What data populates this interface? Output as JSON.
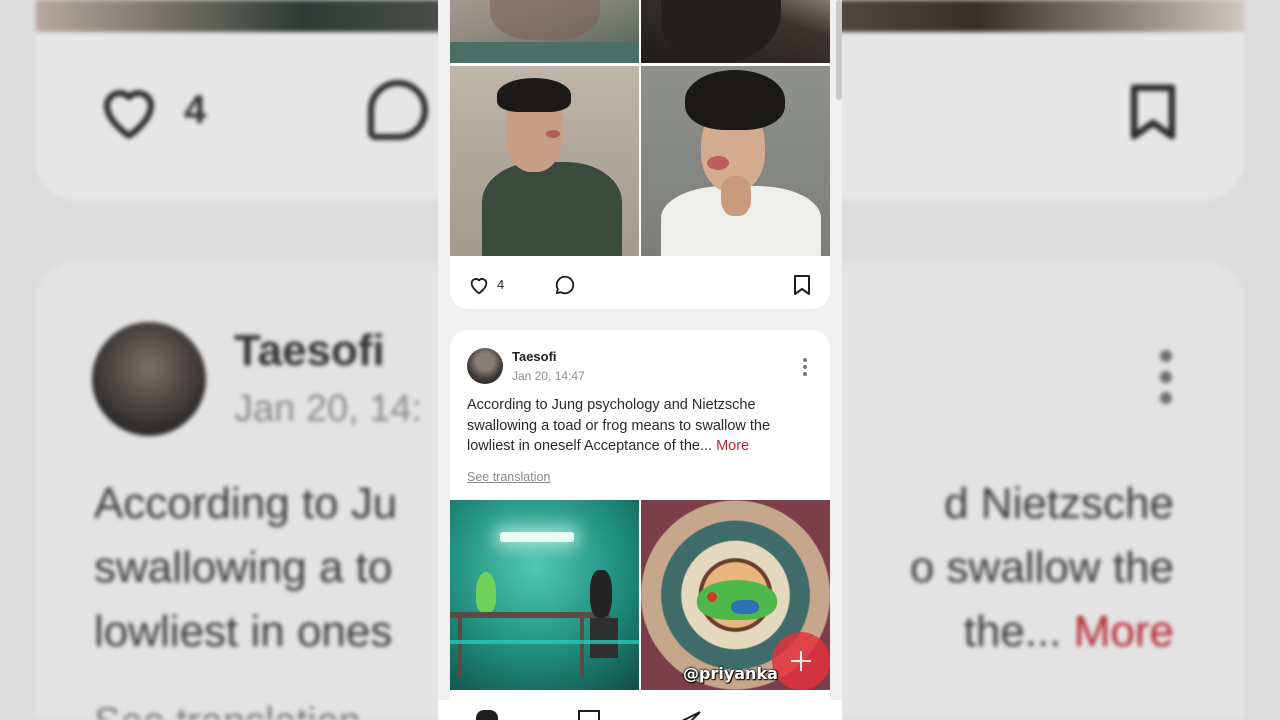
{
  "feed": {
    "post_above": {
      "likes": "4"
    },
    "post": {
      "author": "Taesofi",
      "date": "Jan 20, 14:47",
      "text": "According to Jung psychology and Nietzsche swallowing a toad or frog means to swallow the lowliest in oneself Acceptance of the...",
      "more_label": "More",
      "see_translation": "See translation"
    }
  },
  "background_zoom": {
    "likes": "4",
    "author": "Taesofi",
    "date_partial": "Jan 20, 14:",
    "text_line1": "According to Ju",
    "text_line1_right": "d Nietzsche",
    "text_line2": "swallowing a to",
    "text_line2_right": "o swallow the",
    "text_line3": "lowliest in ones",
    "text_line3_right": "the...",
    "more_label": "More",
    "bottom_partial": "See translation"
  },
  "watermark": "@priyanka",
  "icons": {
    "like": "heart-icon",
    "comment": "comment-bubble-icon",
    "save": "bookmark-icon",
    "menu": "more-vertical-icon",
    "compose": "plus-icon"
  },
  "colors": {
    "accent": "#c4222f",
    "fab": "#e3323e"
  }
}
